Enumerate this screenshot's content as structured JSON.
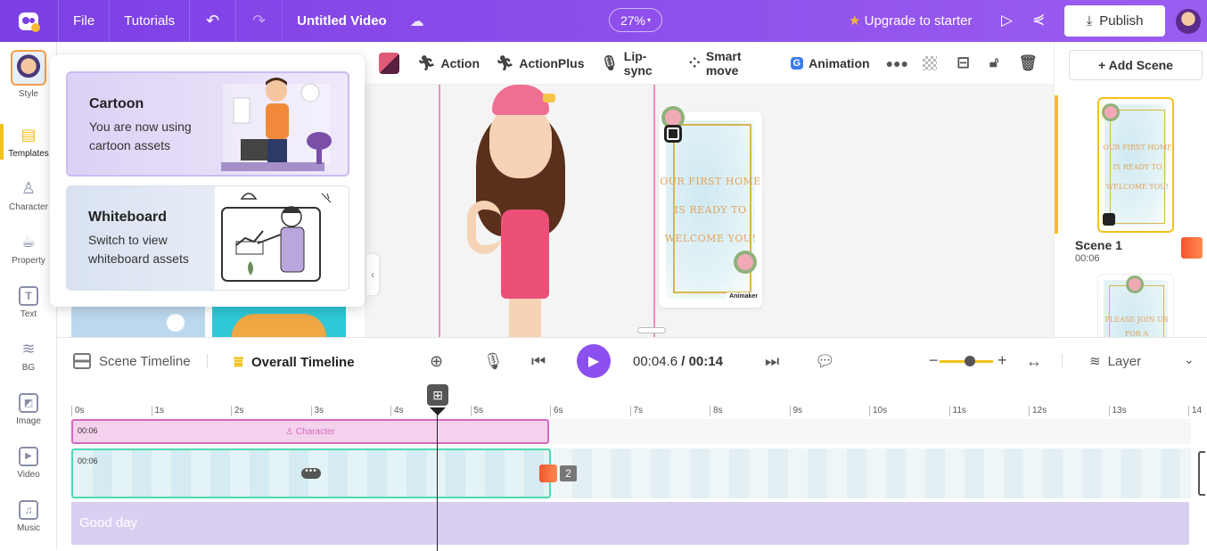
{
  "topbar": {
    "menu_file": "File",
    "menu_tutorials": "Tutorials",
    "project_title": "Untitled Video",
    "zoom": "27%",
    "upgrade": "Upgrade to starter",
    "publish": "Publish",
    "gradient_start": "#7b3fe4",
    "gradient_end": "#9b5cf0"
  },
  "sidebar": {
    "items": [
      {
        "label": "Style",
        "icon": "avatar-icon"
      },
      {
        "label": "Templates",
        "icon": "templates-icon"
      },
      {
        "label": "Character",
        "icon": "person-icon"
      },
      {
        "label": "Property",
        "icon": "cup-icon"
      },
      {
        "label": "Text",
        "icon": "text-icon"
      },
      {
        "label": "BG",
        "icon": "layers-icon"
      },
      {
        "label": "Image",
        "icon": "image-icon"
      },
      {
        "label": "Video",
        "icon": "play-icon"
      },
      {
        "label": "Music",
        "icon": "music-icon"
      }
    ],
    "active": "Templates",
    "accent": "#f2c21b"
  },
  "style_panel": {
    "cartoon": {
      "title": "Cartoon",
      "desc": "You are now using cartoon assets"
    },
    "whiteboard": {
      "title": "Whiteboard",
      "desc": "Switch to view whiteboard assets"
    }
  },
  "toolbar": {
    "action": "Action",
    "action_plus": "ActionPlus",
    "lip_sync": "Lip-sync",
    "smart_move": "Smart move",
    "animation": "Animation"
  },
  "canvas": {
    "card_lines": [
      "OUR FIRST HOME",
      "IS READY TO",
      "WELCOME YOU!"
    ],
    "badge": "Animaker"
  },
  "scenes": {
    "add_label": "+ Add Scene",
    "list": [
      {
        "name": "Scene 1",
        "duration": "00:06",
        "lines": [
          "OUR FIRST HOME",
          "IS READY TO",
          "WELCOME YOU!"
        ]
      },
      {
        "lines": [
          "PLEASE JOIN US",
          "FOR A HOUSEWARMING"
        ]
      }
    ]
  },
  "timeline": {
    "scene_tab": "Scene Timeline",
    "overall_tab": "Overall Timeline",
    "current_time": "00:04.6",
    "separator": " / ",
    "total_time": "00:14",
    "layer": "Layer",
    "ticks": [
      "0s",
      "1s",
      "2s",
      "3s",
      "4s",
      "5s",
      "6s",
      "7s",
      "8s",
      "9s",
      "10s",
      "11s",
      "12s",
      "13s",
      "14"
    ],
    "char_track": {
      "duration": "00:06",
      "label": "Character"
    },
    "bg_track": {
      "duration": "00:06",
      "scene_count": "2"
    },
    "text_track": {
      "text": "Good day"
    },
    "play_color": "#8c4ff0"
  }
}
